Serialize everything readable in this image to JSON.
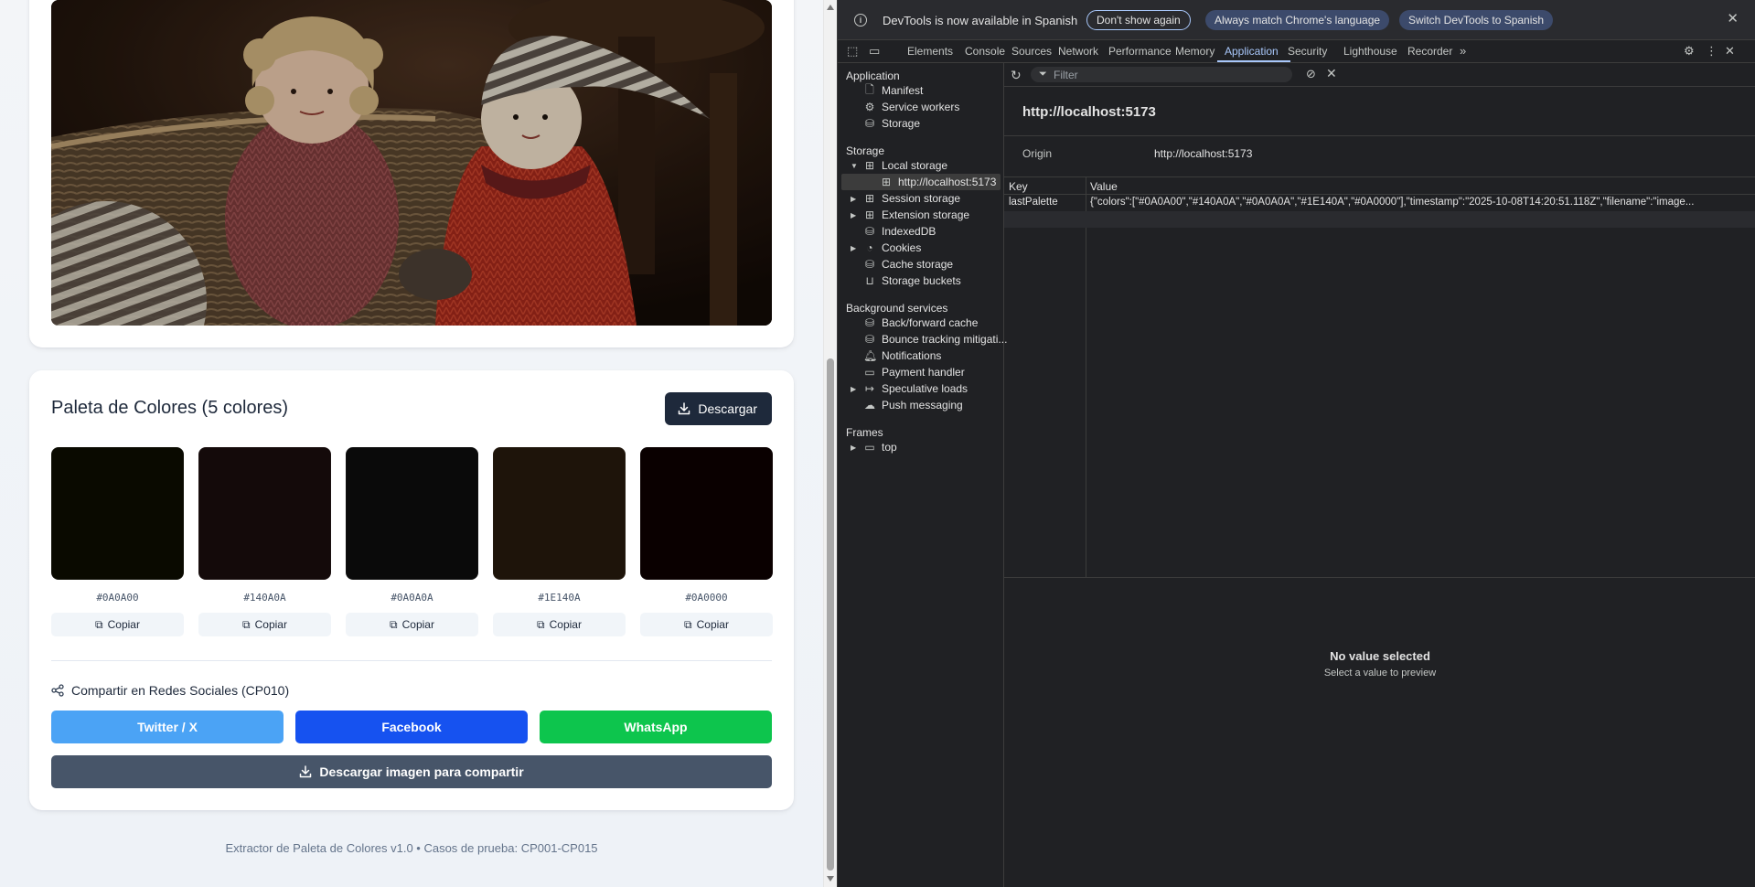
{
  "palette": {
    "title": "Paleta de Colores (5 colores)",
    "download_label": "Descargar",
    "copy_label": "Copiar",
    "swatches": [
      {
        "hex": "#0A0A00",
        "color": "#0a0a00"
      },
      {
        "hex": "#140A0A",
        "color": "#140a0a"
      },
      {
        "hex": "#0A0A0A",
        "color": "#0a0a0a"
      },
      {
        "hex": "#1E140A",
        "color": "#1e140a"
      },
      {
        "hex": "#0A0000",
        "color": "#0a0000"
      }
    ]
  },
  "share": {
    "title": "Compartir en Redes Sociales (CP010)",
    "twitter_label": "Twitter / X",
    "facebook_label": "Facebook",
    "whatsapp_label": "WhatsApp",
    "download_image_label": "Descargar imagen para compartir",
    "colors": {
      "twitter": "#4ba3f5",
      "facebook": "#1652f0",
      "whatsapp": "#0dc54d"
    }
  },
  "footer": {
    "text": "Extractor de Paleta de Colores v1.0 • Casos de prueba: CP001-CP015"
  },
  "devtools": {
    "infobar": {
      "message": "DevTools is now available in Spanish",
      "dont_show": "Don't show again",
      "always_match": "Always match Chrome's language",
      "switch": "Switch DevTools to Spanish"
    },
    "tabs": [
      "Elements",
      "Console",
      "Sources",
      "Network",
      "Performance",
      "Memory",
      "Application",
      "Security",
      "Lighthouse",
      "Recorder"
    ],
    "active_tab": "Application",
    "sidebar": {
      "application_heading": "Application",
      "application_items": [
        "Manifest",
        "Service workers",
        "Storage"
      ],
      "storage_heading": "Storage",
      "storage_items": [
        "Local storage",
        "http://localhost:5173",
        "Session storage",
        "Extension storage",
        "IndexedDB",
        "Cookies",
        "Cache storage",
        "Storage buckets"
      ],
      "background_heading": "Background services",
      "background_items": [
        "Back/forward cache",
        "Bounce tracking mitigati...",
        "Notifications",
        "Payment handler",
        "Speculative loads",
        "Push messaging"
      ],
      "frames_heading": "Frames",
      "frames_items": [
        "top"
      ]
    },
    "filter_placeholder": "Filter",
    "origin_title": "http://localhost:5173",
    "origin_label": "Origin",
    "origin_value": "http://localhost:5173",
    "table": {
      "key_header": "Key",
      "value_header": "Value",
      "rows": [
        {
          "key": "lastPalette",
          "value": "{\"colors\":[\"#0A0A00\",\"#140A0A\",\"#0A0A0A\",\"#1E140A\",\"#0A0000\"],\"timestamp\":\"2025-10-08T14:20:51.118Z\",\"filename\":\"image..."
        }
      ]
    },
    "preview": {
      "title": "No value selected",
      "subtitle": "Select a value to preview"
    },
    "accent": "#a8c7fa"
  }
}
